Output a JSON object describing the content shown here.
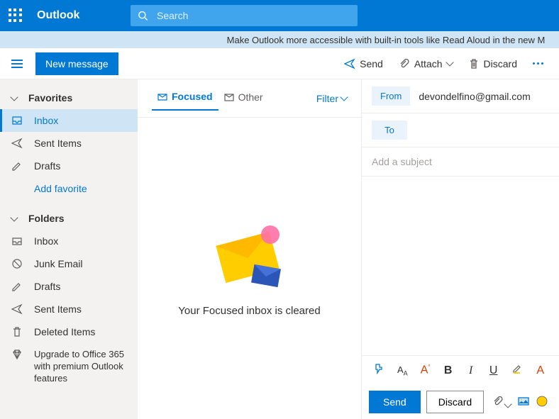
{
  "header": {
    "brand": "Outlook",
    "search_placeholder": "Search"
  },
  "banner": {
    "text": "Make Outlook more accessible with built-in tools like Read Aloud in the new M"
  },
  "toolbar": {
    "new_message": "New message",
    "send": "Send",
    "attach": "Attach",
    "discard": "Discard"
  },
  "sidebar": {
    "favorites_label": "Favorites",
    "folders_label": "Folders",
    "add_favorite": "Add favorite",
    "fav_items": [
      {
        "label": "Inbox",
        "icon": "inbox"
      },
      {
        "label": "Sent Items",
        "icon": "sent"
      },
      {
        "label": "Drafts",
        "icon": "drafts"
      }
    ],
    "folder_items": [
      {
        "label": "Inbox",
        "icon": "inbox2"
      },
      {
        "label": "Junk Email",
        "icon": "junk"
      },
      {
        "label": "Drafts",
        "icon": "drafts"
      },
      {
        "label": "Sent Items",
        "icon": "sent"
      },
      {
        "label": "Deleted Items",
        "icon": "trash"
      }
    ],
    "upgrade": "Upgrade to Office 365 with premium Outlook features"
  },
  "tabs": {
    "focused": "Focused",
    "other": "Other",
    "filter": "Filter"
  },
  "empty": {
    "text": "Your Focused inbox is cleared"
  },
  "compose": {
    "from_label": "From",
    "from_value": "devondelfino@gmail.com",
    "to_label": "To",
    "to_value": "",
    "subject_placeholder": "Add a subject",
    "send": "Send",
    "discard": "Discard"
  }
}
